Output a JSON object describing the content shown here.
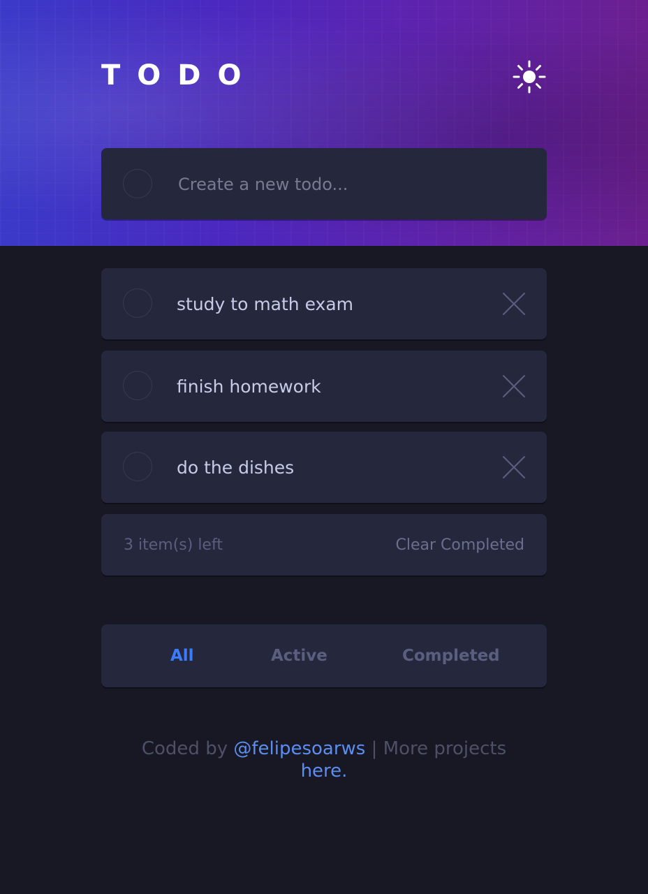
{
  "header": {
    "title": "TODO",
    "theme_toggle_icon": "sun-icon"
  },
  "new_todo": {
    "placeholder": "Create a new todo..."
  },
  "todos": [
    {
      "text": "study to math exam",
      "completed": false
    },
    {
      "text": "finish homework",
      "completed": false
    },
    {
      "text": "do the dishes",
      "completed": false
    }
  ],
  "footer": {
    "items_left": "3 item(s) left",
    "clear_label": "Clear Completed"
  },
  "filters": {
    "all": "All",
    "active": "Active",
    "completed": "Completed",
    "selected": "All"
  },
  "attribution": {
    "prefix": "Coded by ",
    "author": "@felipesoarws",
    "middle": " | More projects ",
    "link": "here."
  },
  "colors": {
    "background": "#181824",
    "card": "#25273d",
    "text": "#c8cbe7",
    "muted": "#5b5e7e",
    "accent": "#3a7cfd",
    "link": "#5b8ef0"
  }
}
